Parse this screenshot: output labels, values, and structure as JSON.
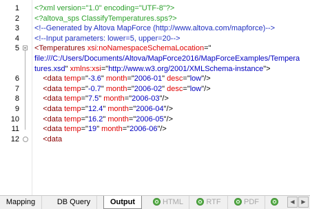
{
  "editor": {
    "lines": [
      {
        "n": "1",
        "parts": [
          {
            "c": "pi",
            "t": "<?xml version=\"1.0\" encoding=\"UTF-8\"?>"
          }
        ]
      },
      {
        "n": "2",
        "parts": [
          {
            "c": "pi",
            "t": "<?altova_sps ClassifyTemperatures.sps?>"
          }
        ]
      },
      {
        "n": "3",
        "parts": [
          {
            "c": "cm",
            "t": "<!--Generated by Altova MapForce (http://www.altova.com/mapforce)-->"
          }
        ]
      },
      {
        "n": "4",
        "parts": [
          {
            "c": "cm",
            "t": "<!--Input parameters: lower=5, upper=20-->"
          }
        ]
      },
      {
        "n": "5",
        "fold": true,
        "parts": [
          {
            "c": "tg",
            "t": "<Temperatures "
          },
          {
            "c": "at",
            "t": "xsi:noNamespaceSchemaLocation"
          },
          {
            "c": "tx",
            "t": "=\""
          }
        ]
      },
      {
        "n": "",
        "parts": [
          {
            "c": "av",
            "t": "file:///C:/Users/Documents/Altova/MapForce2016/MapForceExamples/Tempera"
          }
        ]
      },
      {
        "n": "",
        "parts": [
          {
            "c": "av",
            "t": "tures.xsd"
          },
          {
            "c": "tx",
            "t": "\" "
          },
          {
            "c": "at",
            "t": "xmlns:xsi"
          },
          {
            "c": "tx",
            "t": "=\""
          },
          {
            "c": "av",
            "t": "http://www.w3.org/2001/XMLSchema-instance"
          },
          {
            "c": "tx",
            "t": "\">"
          }
        ]
      },
      {
        "n": "6",
        "parts": [
          {
            "c": "tx",
            "t": "    "
          },
          {
            "c": "tg",
            "t": "<data "
          },
          {
            "c": "at",
            "t": "temp"
          },
          {
            "c": "tx",
            "t": "=\""
          },
          {
            "c": "av",
            "t": "-3.6"
          },
          {
            "c": "tx",
            "t": "\" "
          },
          {
            "c": "at",
            "t": "month"
          },
          {
            "c": "tx",
            "t": "=\""
          },
          {
            "c": "av",
            "t": "2006-01"
          },
          {
            "c": "tx",
            "t": "\" "
          },
          {
            "c": "at",
            "t": "desc"
          },
          {
            "c": "tx",
            "t": "=\""
          },
          {
            "c": "av",
            "t": "low"
          },
          {
            "c": "tx",
            "t": "\"/>"
          }
        ]
      },
      {
        "n": "7",
        "parts": [
          {
            "c": "tx",
            "t": "    "
          },
          {
            "c": "tg",
            "t": "<data "
          },
          {
            "c": "at",
            "t": "temp"
          },
          {
            "c": "tx",
            "t": "=\""
          },
          {
            "c": "av",
            "t": "-0.7"
          },
          {
            "c": "tx",
            "t": "\" "
          },
          {
            "c": "at",
            "t": "month"
          },
          {
            "c": "tx",
            "t": "=\""
          },
          {
            "c": "av",
            "t": "2006-02"
          },
          {
            "c": "tx",
            "t": "\" "
          },
          {
            "c": "at",
            "t": "desc"
          },
          {
            "c": "tx",
            "t": "=\""
          },
          {
            "c": "av",
            "t": "low"
          },
          {
            "c": "tx",
            "t": "\"/>"
          }
        ]
      },
      {
        "n": "8",
        "parts": [
          {
            "c": "tx",
            "t": "    "
          },
          {
            "c": "tg",
            "t": "<data "
          },
          {
            "c": "at",
            "t": "temp"
          },
          {
            "c": "tx",
            "t": "=\""
          },
          {
            "c": "av",
            "t": "7.5"
          },
          {
            "c": "tx",
            "t": "\" "
          },
          {
            "c": "at",
            "t": "month"
          },
          {
            "c": "tx",
            "t": "=\""
          },
          {
            "c": "av",
            "t": "2006-03"
          },
          {
            "c": "tx",
            "t": "\"/>"
          }
        ]
      },
      {
        "n": "9",
        "parts": [
          {
            "c": "tx",
            "t": "    "
          },
          {
            "c": "tg",
            "t": "<data "
          },
          {
            "c": "at",
            "t": "temp"
          },
          {
            "c": "tx",
            "t": "=\""
          },
          {
            "c": "av",
            "t": "12.4"
          },
          {
            "c": "tx",
            "t": "\" "
          },
          {
            "c": "at",
            "t": "month"
          },
          {
            "c": "tx",
            "t": "=\""
          },
          {
            "c": "av",
            "t": "2006-04"
          },
          {
            "c": "tx",
            "t": "\"/>"
          }
        ]
      },
      {
        "n": "10",
        "parts": [
          {
            "c": "tx",
            "t": "    "
          },
          {
            "c": "tg",
            "t": "<data "
          },
          {
            "c": "at",
            "t": "temp"
          },
          {
            "c": "tx",
            "t": "=\""
          },
          {
            "c": "av",
            "t": "16.2"
          },
          {
            "c": "tx",
            "t": "\" "
          },
          {
            "c": "at",
            "t": "month"
          },
          {
            "c": "tx",
            "t": "=\""
          },
          {
            "c": "av",
            "t": "2006-05"
          },
          {
            "c": "tx",
            "t": "\"/>"
          }
        ]
      },
      {
        "n": "11",
        "parts": [
          {
            "c": "tx",
            "t": "    "
          },
          {
            "c": "tg",
            "t": "<data "
          },
          {
            "c": "at",
            "t": "temp"
          },
          {
            "c": "tx",
            "t": "=\""
          },
          {
            "c": "av",
            "t": "19"
          },
          {
            "c": "tx",
            "t": "\" "
          },
          {
            "c": "at",
            "t": "month"
          },
          {
            "c": "tx",
            "t": "=\""
          },
          {
            "c": "av",
            "t": "2006-06"
          },
          {
            "c": "tx",
            "t": "\"/>"
          }
        ]
      },
      {
        "n": "12",
        "end": true,
        "parts": [
          {
            "c": "tx",
            "t": "    "
          },
          {
            "c": "tg",
            "t": "<data"
          }
        ]
      }
    ]
  },
  "tabs": [
    {
      "label": "Mapping",
      "active": false,
      "disabled": false,
      "icon": false
    },
    {
      "label": "DB Query",
      "active": false,
      "disabled": false,
      "icon": false
    },
    {
      "label": "Output",
      "active": true,
      "disabled": false,
      "icon": false
    },
    {
      "label": "HTML",
      "active": false,
      "disabled": true,
      "icon": "preview-icon"
    },
    {
      "label": "RTF",
      "active": false,
      "disabled": true,
      "icon": "preview-icon"
    },
    {
      "label": "PDF",
      "active": false,
      "disabled": true,
      "icon": "preview-icon"
    },
    {
      "label": "",
      "active": false,
      "disabled": true,
      "icon": "preview-icon"
    }
  ],
  "colors": {
    "processing_instruction": "#2ca02c",
    "comment": "#2030c0",
    "tag": "#8b0000",
    "attribute": "#e00000",
    "attribute_value": "#0000c0"
  },
  "scroll_buttons": {
    "left_icon": "scroll-left-icon",
    "right_icon": "scroll-right-icon"
  }
}
